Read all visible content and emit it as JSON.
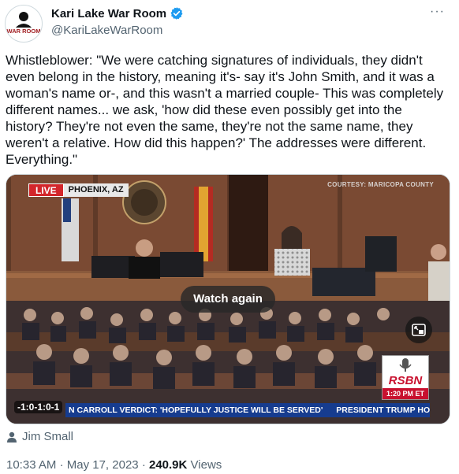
{
  "author": {
    "avatar_icon": "war-room-logo-icon",
    "avatar_text": "WAR ROOM",
    "display_name": "Kari Lake War Room",
    "verified_icon": "verified-badge-icon",
    "handle": "@KariLakeWarRoom"
  },
  "more_icon": "more-options-icon",
  "tweet_text": "Whistleblower: \"We were catching signatures of individuals, they didn't even belong in the history, meaning it's- say it's John Smith, and it was a woman's name or-, and this wasn't a married couple- This was completely different names... we ask, 'how did these even possibly get into the history? They're not even the same, they're not the same name, they weren't a relative. How did this happen?' The addresses were different. Everything.\"",
  "video": {
    "live_label": "LIVE",
    "location": "PHOENIX, AZ",
    "courtesy": "COURTESY: MARICOPA COUNTY",
    "watch_again": "Watch again",
    "pip_icon": "picture-in-picture-icon",
    "rsbn_logo": "RSBN",
    "rsbn_time": "1:20 PM ET",
    "ticker_items": [
      "N CARROLL VERDICT: 'HOPEFULLY JUSTICE WILL BE SERVED'",
      "PRESIDENT TRUMP HOLD"
    ],
    "timer": "-1:0-1:0-1"
  },
  "credit": {
    "icon": "person-icon",
    "name": "Jim Small"
  },
  "meta": {
    "time": "10:33 AM",
    "date": "May 17, 2023",
    "separator": "·",
    "views_count": "240.9K",
    "views_label": "Views"
  },
  "colors": {
    "text_primary": "#0f1419",
    "text_secondary": "#536471",
    "verified_blue": "#1d9bf0",
    "live_red": "#d3262b",
    "ticker_blue": "#163c8f"
  }
}
